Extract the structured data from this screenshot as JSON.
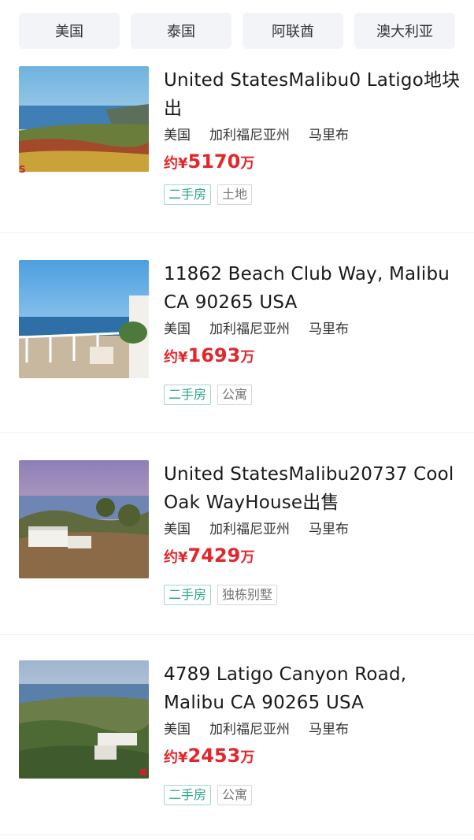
{
  "tabs": [
    "美国",
    "泰国",
    "阿联酋",
    "澳大利亚"
  ],
  "listings": [
    {
      "title": "United StatesMalibu0 Latigo地块出",
      "country": "美国",
      "state": "加利福尼亚州",
      "city": "马里布",
      "price_prefix": "约¥",
      "price": "5170",
      "price_unit": "万",
      "type_tag": "二手房",
      "category_tag": "土地",
      "image_marker": "S"
    },
    {
      "title": "11862 Beach Club Way, Malibu CA 90265 USA",
      "country": "美国",
      "state": "加利福尼亚州",
      "city": "马里布",
      "price_prefix": "约¥",
      "price": "1693",
      "price_unit": "万",
      "type_tag": "二手房",
      "category_tag": "公寓"
    },
    {
      "title": "United StatesMalibu20737 Cool Oak WayHouse出售",
      "country": "美国",
      "state": "加利福尼亚州",
      "city": "马里布",
      "price_prefix": "约¥",
      "price": "7429",
      "price_unit": "万",
      "type_tag": "二手房",
      "category_tag": "独栋别墅"
    },
    {
      "title": "4789 Latigo Canyon Road, Malibu CA 90265 USA",
      "country": "美国",
      "state": "加利福尼亚州",
      "city": "马里布",
      "price_prefix": "约¥",
      "price": "2453",
      "price_unit": "万",
      "type_tag": "二手房",
      "category_tag": "公寓"
    }
  ],
  "colors": {
    "price": "#e2262b",
    "type_tag": "#2aa58a",
    "tab_bg": "#f2f4f8"
  }
}
